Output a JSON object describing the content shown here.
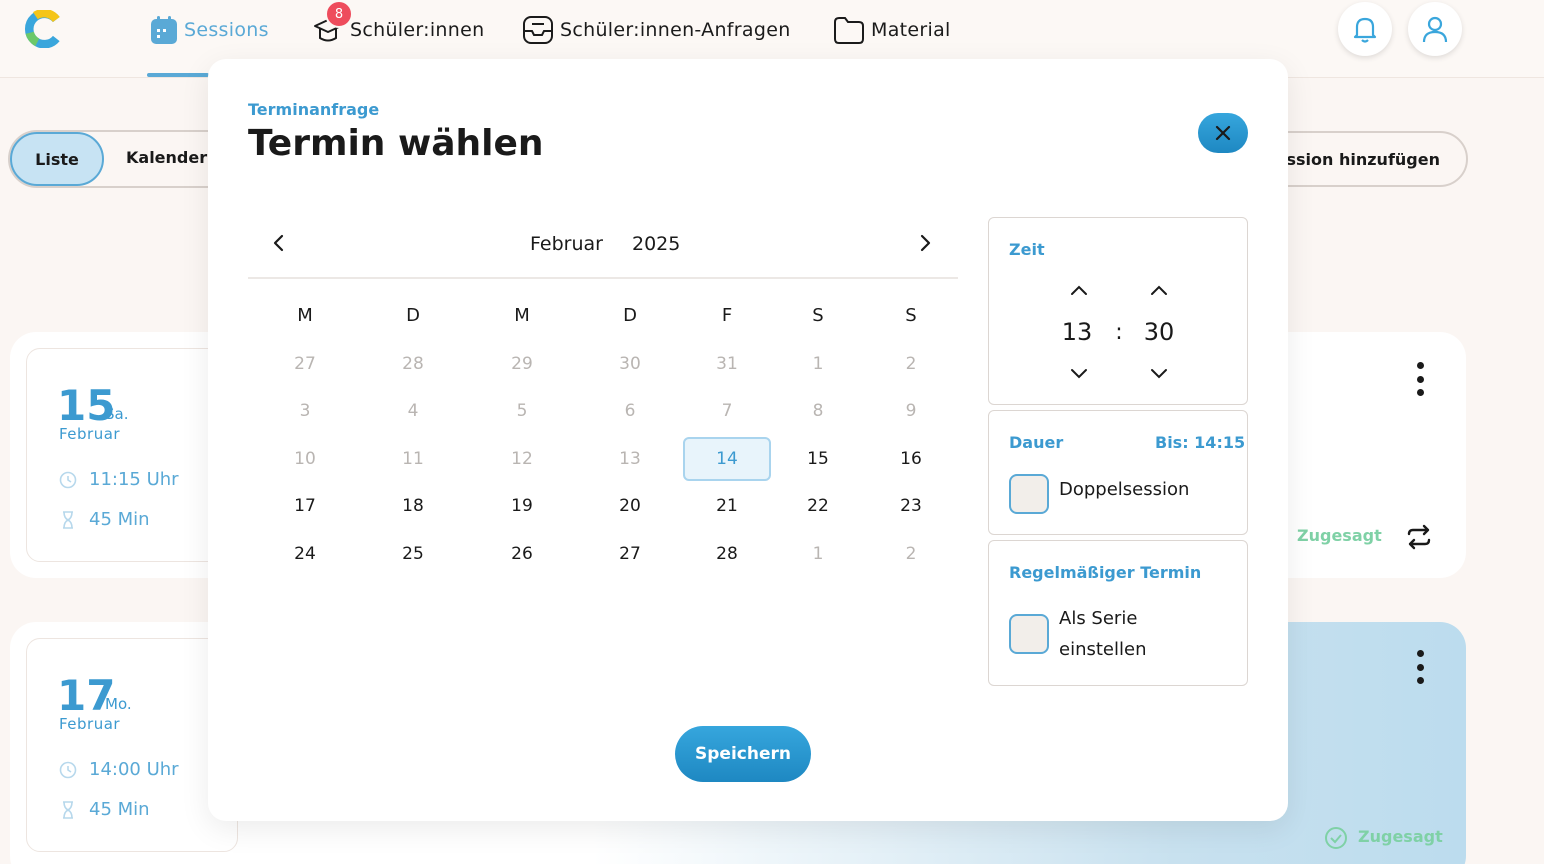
{
  "nav": {
    "items": [
      {
        "label": "Sessions",
        "icon": "calendar-icon"
      },
      {
        "label": "Schüler:innen",
        "icon": "graduation-cap-icon",
        "badge": "8"
      },
      {
        "label": "Schüler:innen-Anfragen",
        "icon": "inbox-icon"
      },
      {
        "label": "Material",
        "icon": "folder-icon"
      }
    ]
  },
  "page": {
    "view_toggle": {
      "list": "Liste",
      "calendar": "Kalender"
    },
    "add_session": "ession hinzufügen",
    "sessions": [
      {
        "day": "15",
        "weekday": "Sa.",
        "month": "Februar",
        "time": "11:15 Uhr",
        "duration": "45 Min",
        "status": "Zugesagt"
      },
      {
        "day": "17",
        "weekday": "Mo.",
        "month": "Februar",
        "time": "14:00 Uhr",
        "duration": "45 Min",
        "status": "Zugesagt"
      }
    ]
  },
  "modal": {
    "kicker": "Terminanfrage",
    "title": "Termin wählen",
    "calendar": {
      "month": "Februar",
      "year": "2025",
      "weekdays": [
        "M",
        "D",
        "M",
        "D",
        "F",
        "S",
        "S"
      ],
      "weeks": [
        [
          "27",
          "28",
          "29",
          "30",
          "31",
          "1",
          "2"
        ],
        [
          "3",
          "4",
          "5",
          "6",
          "7",
          "8",
          "9"
        ],
        [
          "10",
          "11",
          "12",
          "13",
          "14",
          "15",
          "16"
        ],
        [
          "17",
          "18",
          "19",
          "20",
          "21",
          "22",
          "23"
        ],
        [
          "24",
          "25",
          "26",
          "27",
          "28",
          "1",
          "2"
        ]
      ],
      "selected_day": "14"
    },
    "time": {
      "label": "Zeit",
      "hour": "13",
      "separator": ":",
      "minute": "30"
    },
    "duration": {
      "label": "Dauer",
      "until": "Bis: 14:15",
      "double_session": "Doppelsession"
    },
    "recurring": {
      "label": "Regelmäßiger Termin",
      "series_line1": "Als Serie",
      "series_line2": "einstellen"
    },
    "save": "Speichern"
  },
  "colors": {
    "accent": "#3c9ad0",
    "accent_light": "#5aa9d6",
    "badge": "#ee4c5c",
    "success": "#7fd1a6"
  }
}
